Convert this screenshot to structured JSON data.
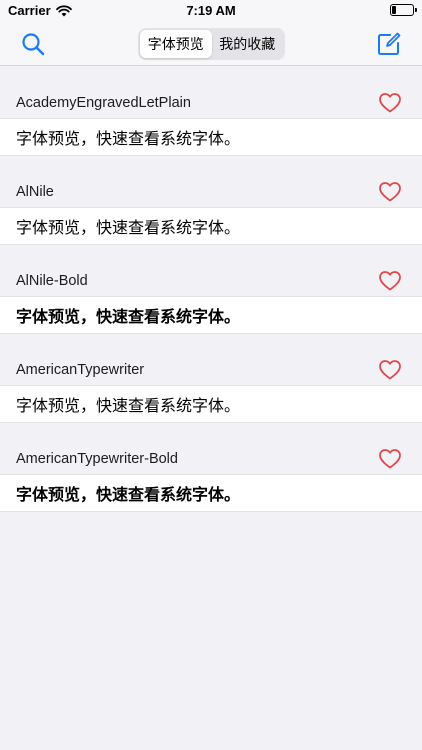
{
  "status_bar": {
    "carrier": "Carrier",
    "time": "7:19 AM",
    "battery_level": 0.2
  },
  "nav": {
    "search_icon": "search-icon",
    "compose_icon": "compose-icon",
    "segments": [
      {
        "label": "字体预览",
        "selected": true
      },
      {
        "label": "我的收藏",
        "selected": false
      }
    ]
  },
  "colors": {
    "accent": "#1a7bf2",
    "heart": "#e0474c",
    "background": "#f2f1f6"
  },
  "fonts": [
    {
      "name": "AcademyEngravedLetPlain",
      "preview": "字体预览，快速查看系统字体。",
      "bold": false
    },
    {
      "name": "AlNile",
      "preview": "字体预览，快速查看系统字体。",
      "bold": false
    },
    {
      "name": "AlNile-Bold",
      "preview": "字体预览，快速查看系统字体。",
      "bold": true
    },
    {
      "name": "AmericanTypewriter",
      "preview": "字体预览，快速查看系统字体。",
      "bold": false
    },
    {
      "name": "AmericanTypewriter-Bold",
      "preview": "字体预览，快速查看系统字体。",
      "bold": true
    }
  ]
}
